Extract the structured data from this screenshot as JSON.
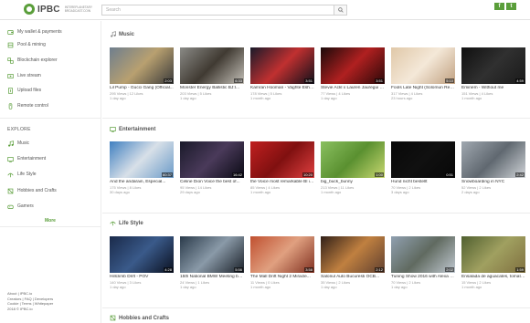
{
  "header": {
    "logo_text": "IPBC",
    "logo_sub": "INTEREPLANETARY BROADCAST.COIN",
    "search_placeholder": "Search",
    "facebook_glyph": "f",
    "twitter_glyph": "t"
  },
  "sidebar": {
    "top_items": [
      {
        "label": "My wallet & payments",
        "icon": "wallet-icon"
      },
      {
        "label": "Pool & mining",
        "icon": "pool-icon"
      },
      {
        "label": "Blockchain explorer",
        "icon": "blockchain-icon"
      },
      {
        "label": "Live stream",
        "icon": "live-icon"
      },
      {
        "label": "Upload files",
        "icon": "upload-icon"
      },
      {
        "label": "Remote control",
        "icon": "remote-icon"
      }
    ],
    "explore_title": "EXPLORE",
    "explore_items": [
      {
        "label": "Music",
        "icon": "music-icon"
      },
      {
        "label": "Entertainment",
        "icon": "entertainment-icon"
      },
      {
        "label": "Life Style",
        "icon": "lifestyle-icon"
      },
      {
        "label": "Hobbies and Crafts",
        "icon": "hobbies-icon"
      },
      {
        "label": "Gamers",
        "icon": "gamers-icon"
      }
    ],
    "more_label": "More",
    "footer": {
      "line1": "About  |  IPBC.io",
      "line2": "Creators  |  FAQ  |  Developers",
      "line3": "Cookie  |  Terms  |  Whitepaper",
      "line4": "2018 © IPBC.io"
    }
  },
  "sections": [
    {
      "title": "Music",
      "icon": "music-icon",
      "videos": [
        {
          "title": "Lil Pump - Gucci Gang (Official...",
          "meta": "295 Views | 12 Likes",
          "age": "1 day ago",
          "duration": "2:03",
          "colors": [
            "#6e7e8e",
            "#b8a070",
            "#3a3a3a"
          ]
        },
        {
          "title": "Monster Energy Ballistic BJ:I...",
          "meta": "203 Views | 5 Likes",
          "age": "1 day ago",
          "duration": "6:33",
          "colors": [
            "#8a8a86",
            "#403a32",
            "#c4c0b8"
          ]
        },
        {
          "title": "Kamran Hooman - Vaghte Esh ghe...",
          "meta": "178 Views | 5 Likes",
          "age": "1 month ago",
          "duration": "3:51",
          "colors": [
            "#1a1a2a",
            "#c03030",
            "#10101a"
          ]
        },
        {
          "title": "Stevie Ackl x Lauren Jauregui - All...",
          "meta": "77 Views | 4 Likes",
          "age": "1 day ago",
          "duration": "3:51",
          "colors": [
            "#1a0a0a",
            "#b02020",
            "#2a0808"
          ]
        },
        {
          "title": "Fools Late Night (Solomun Re mix)...",
          "meta": "317 Views | 4 Likes",
          "age": "23 hours ago",
          "duration": "5:10",
          "colors": [
            "#e0c8a8",
            "#f4e8d8",
            "#c0a080"
          ]
        },
        {
          "title": "Eminem - Without me",
          "meta": "151 Views | 4 Likes",
          "age": "1 month ago",
          "duration": "4:59",
          "colors": [
            "#101010",
            "#303030",
            "#1a1a1a"
          ]
        }
      ]
    },
    {
      "title": "Entertainment",
      "icon": "entertainment-icon",
      "videos": [
        {
          "title": "And the andarain, Especial...",
          "meta": "175 Views | 8 Likes",
          "age": "30 days ago",
          "duration": "60:37",
          "colors": [
            "#4080c0",
            "#d8e0e8",
            "#6a9ac8"
          ]
        },
        {
          "title": "Celine Dion Voice the best of...",
          "meta": "95 Views | 14 Likes",
          "age": "29 days ago",
          "duration": "16:42",
          "colors": [
            "#1a1a2a",
            "#4a3a5a",
            "#0a0a14"
          ]
        },
        {
          "title": "the Voice most remarkable Bl ind...",
          "meta": "85 Views | 4 Likes",
          "age": "1 month ago",
          "duration": "10:20",
          "colors": [
            "#c02020",
            "#801010",
            "#e04040"
          ]
        },
        {
          "title": "big_buck_bunny",
          "meta": "213 Views | 11 Likes",
          "age": "1 month ago",
          "duration": "1:00",
          "colors": [
            "#8ac060",
            "#5a9030",
            "#c8d870"
          ]
        },
        {
          "title": "Hund nicht bestellt",
          "meta": "70 Views | 2 Likes",
          "age": "3 days ago",
          "duration": "0:51",
          "colors": [
            "#080808",
            "#101010",
            "#080808"
          ]
        },
        {
          "title": "Snowboarding in NYC",
          "meta": "52 Views | 2 Likes",
          "age": "2 days ago",
          "duration": "2:42",
          "colors": [
            "#a0a8b0",
            "#606870",
            "#d0d4d8"
          ]
        }
      ]
    },
    {
      "title": "Life Style",
      "icon": "lifestyle-icon",
      "videos": [
        {
          "title": "Hillclimb Drift - POV",
          "meta": "140 Views | 3 Likes",
          "age": "1 day ago",
          "duration": "4:28",
          "colors": [
            "#1a2a4a",
            "#3a5a8a",
            "#0a1020"
          ]
        },
        {
          "title": "15th National BMW Meeting by BMW...",
          "meta": "24 Views | 1 Likes",
          "age": "1 day ago",
          "duration": "5:56",
          "colors": [
            "#2a3a4a",
            "#8a9aa8",
            "#1a2028"
          ]
        },
        {
          "title": "The Mall Drift Night 2 Miracle...",
          "meta": "11 Views | 0 Likes",
          "age": "1 month ago",
          "duration": "3:58",
          "colors": [
            "#c05030",
            "#e0a080",
            "#803020"
          ]
        },
        {
          "title": "Salonul Auto Bucuresti OCB...",
          "meta": "35 Views | 2 Likes",
          "age": "1 day ago",
          "duration": "2:12",
          "colors": [
            "#302018",
            "#c08040",
            "#604030"
          ]
        },
        {
          "title": "Tuning Show 2016 with Alexa nder...",
          "meta": "70 Views | 2 Likes",
          "age": "1 day ago",
          "duration": "2:02",
          "colors": [
            "#90a0b0",
            "#606a60",
            "#c0c8d0"
          ]
        },
        {
          "title": "Ensalada de aguacates, tomates y...",
          "meta": "15 Views | 2 Likes",
          "age": "1 month ago",
          "duration": "1:59",
          "colors": [
            "#506030",
            "#a0a060",
            "#807040"
          ]
        }
      ]
    },
    {
      "title": "Hobbies and Crafts",
      "icon": "hobbies-icon",
      "videos": []
    }
  ]
}
